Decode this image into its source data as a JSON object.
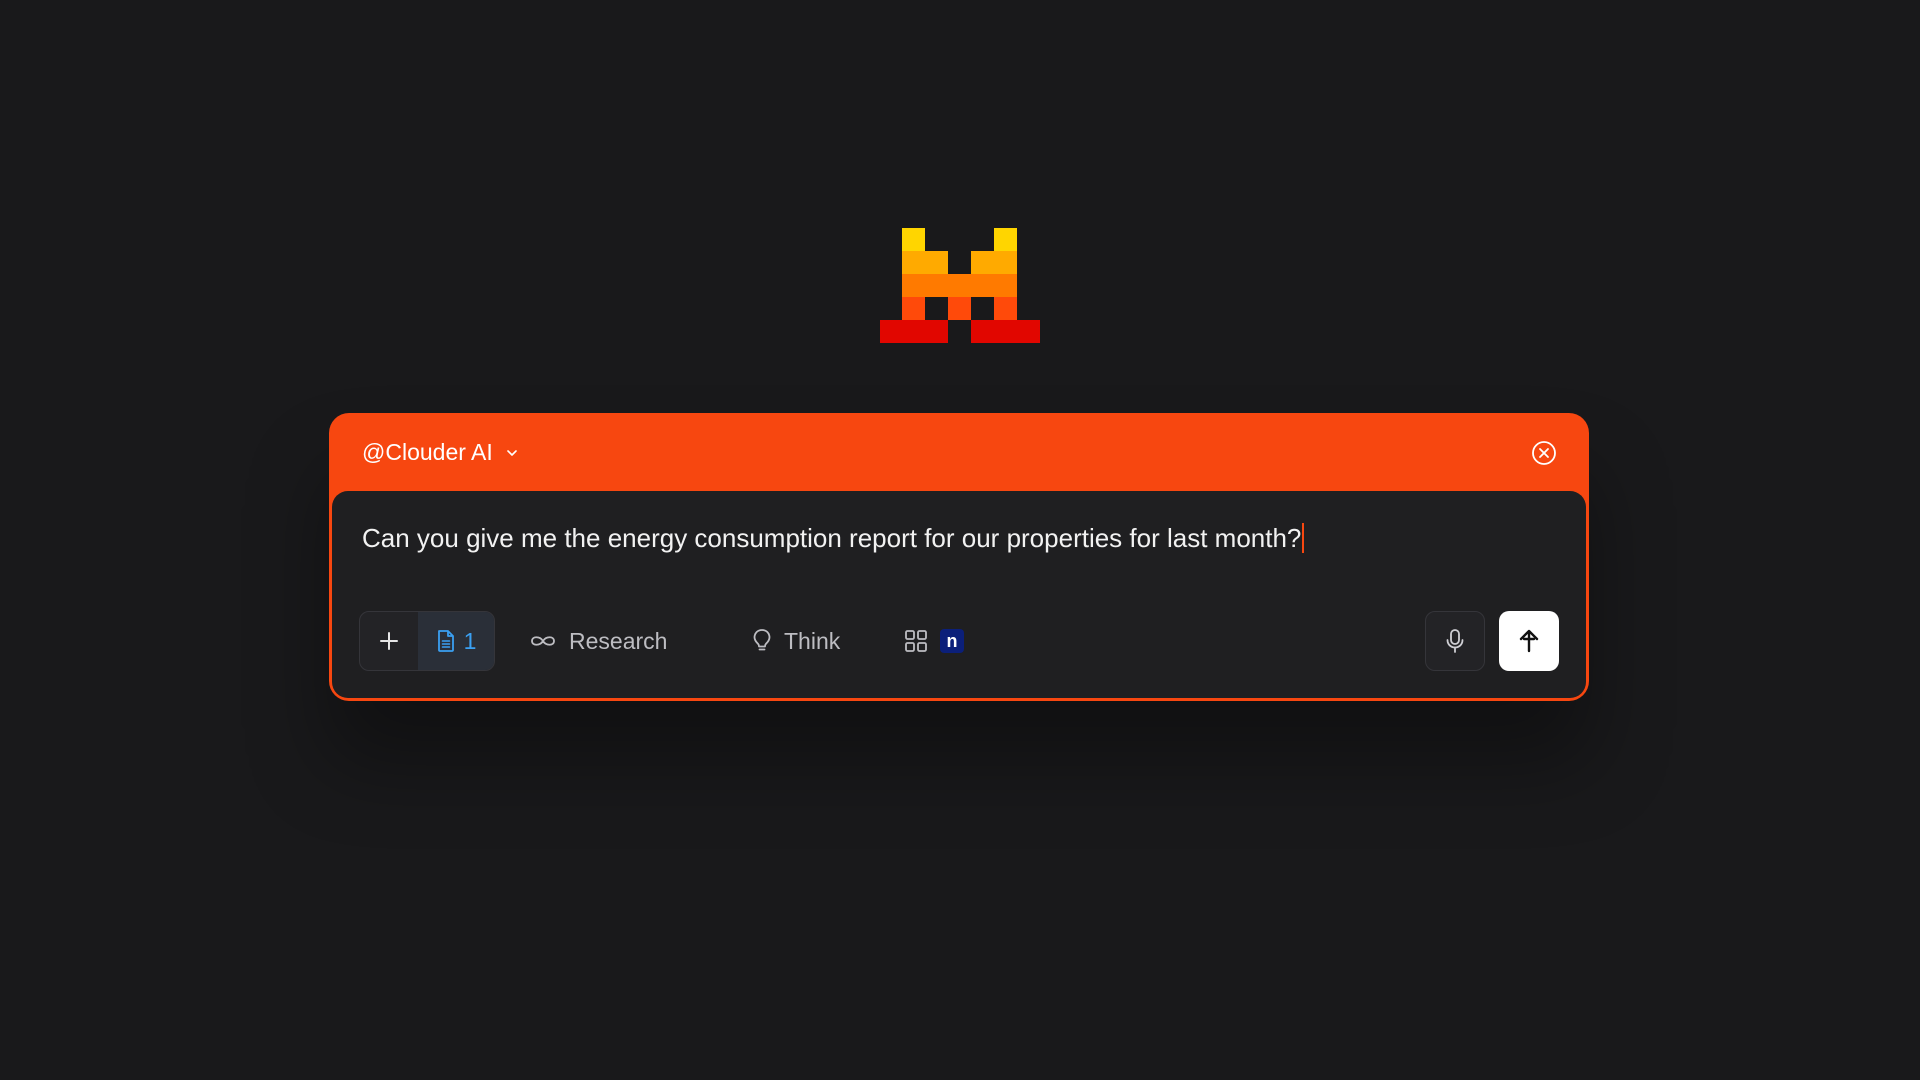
{
  "logo": {
    "name": "logo-icon",
    "colors": [
      "#ffd500",
      "#ffaa00",
      "#ff7a00",
      "#ff4a0a",
      "#e10600"
    ]
  },
  "chat": {
    "agent_label": "@Clouder AI",
    "prompt_text": "Can you give me the energy consumption report for our properties for last month?",
    "accent_color": "#f74710"
  },
  "toolbar": {
    "attached_files_count": "1",
    "research_label": "Research",
    "think_label": "Think",
    "notion_letter": "n"
  },
  "icons": {
    "dropdown": "chevron-down-icon",
    "close": "close-circle-icon",
    "add": "plus-icon",
    "file": "document-icon",
    "research": "infinity-icon",
    "think": "lightbulb-icon",
    "apps": "grid-icon",
    "notion": "notion-icon",
    "mic": "microphone-icon",
    "send": "arrow-up-icon"
  }
}
